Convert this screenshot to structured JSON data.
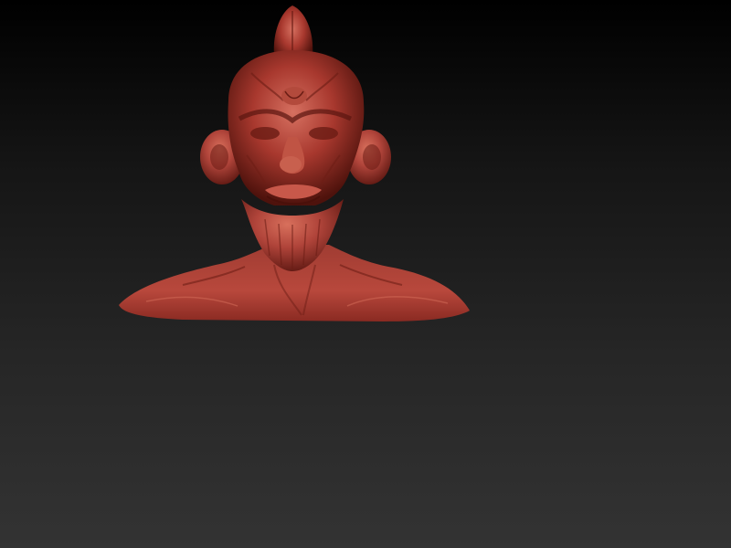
{
  "viewport": {
    "background_top": "#000000",
    "background_bottom": "#333333"
  },
  "model": {
    "kind": "sculpted-bust",
    "material_color": "#a8382e",
    "highlight_color": "#d8705c",
    "shadow_color": "#5a1610"
  }
}
